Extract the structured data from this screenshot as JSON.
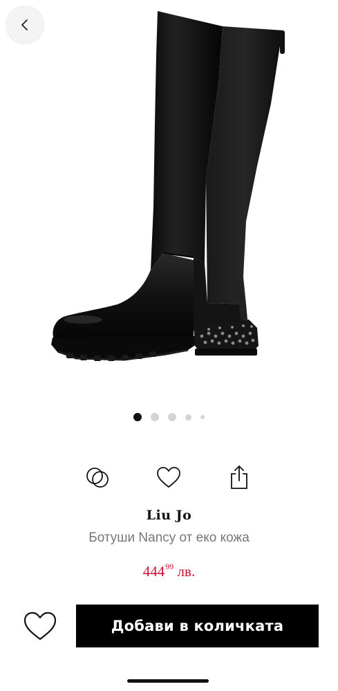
{
  "nav": {
    "back_icon": "chevron-left-icon"
  },
  "gallery": {
    "image": "black knee-high boot with studded heel",
    "slides": 5,
    "active_slide": 1
  },
  "actions": [
    {
      "icon": "compare-circles-icon"
    },
    {
      "icon": "heart-outline-icon"
    },
    {
      "icon": "share-icon"
    }
  ],
  "product": {
    "brand": "Liu Jo",
    "name": "Ботуши Nancy от еко кожа",
    "price_main": "444",
    "price_cents": "99",
    "currency": "лв."
  },
  "bottom": {
    "wishlist_icon": "heart-outline-icon",
    "add_to_cart_label": "Добави в количката"
  },
  "colors": {
    "price": "#c8102e",
    "button_bg": "#000000",
    "button_text": "#ffffff"
  }
}
